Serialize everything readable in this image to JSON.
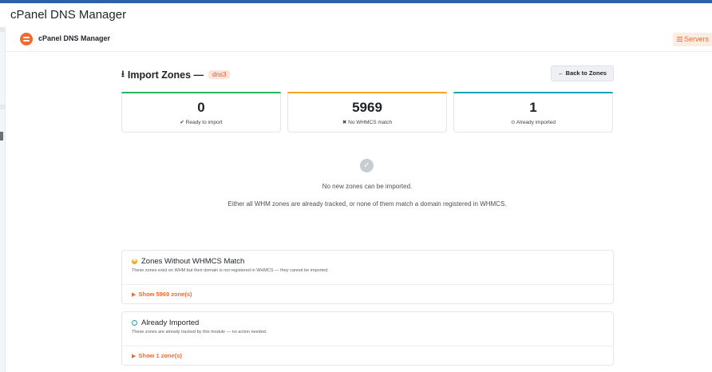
{
  "page": {
    "title": "cPanel DNS Manager"
  },
  "module": {
    "name": "cPanel DNS Manager",
    "servers_label": "Servers",
    "logo_icon": "cpanel-logo-icon",
    "accent_color": "#f26a2e"
  },
  "import": {
    "title": "Import Zones —",
    "server": "dns3",
    "back_label": "← Back to Zones",
    "title_icon": "download-icon"
  },
  "stats": [
    {
      "value": "0",
      "label": "✔ Ready to import",
      "color": "#28b463"
    },
    {
      "value": "5969",
      "label": "✖ No WHMCS match",
      "color": "#f5a623"
    },
    {
      "value": "1",
      "label": "⊙ Already imported",
      "color": "#17a2b8"
    }
  ],
  "empty_state": {
    "icon": "check-circle-icon",
    "title": "No new zones can be imported.",
    "description": "Either all WHM zones are already tracked, or none of them match a domain registered in WHMCS."
  },
  "sections": [
    {
      "title": "Zones Without WHMCS Match",
      "description": "These zones exist on WHM but their domain is not registered in WHMCS — they cannot be imported.",
      "toggle_label": "Show 5969 zone(s)",
      "icon": "warning-circle-icon"
    },
    {
      "title": "Already Imported",
      "description": "These zones are already tracked by this module — no action needed.",
      "toggle_label": "Show 1 zone(s)",
      "icon": "info-circle-icon"
    }
  ]
}
